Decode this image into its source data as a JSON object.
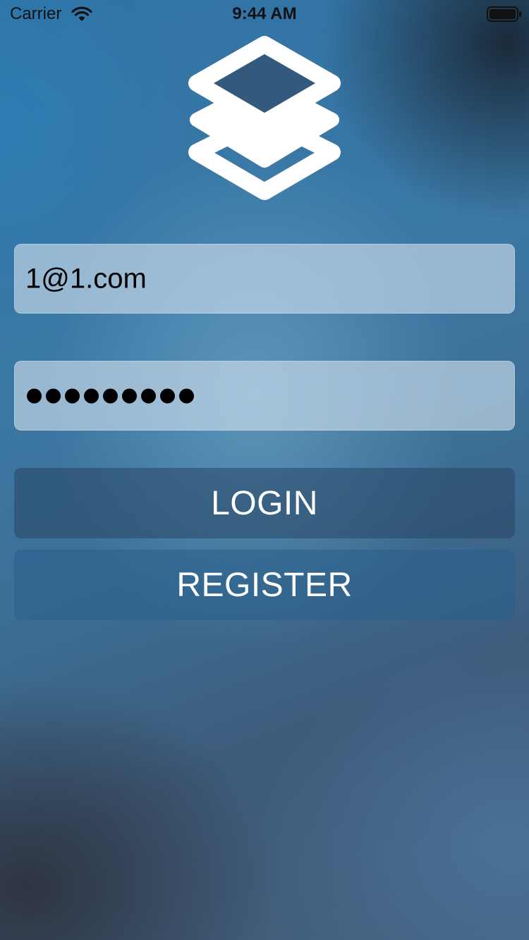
{
  "status_bar": {
    "carrier": "Carrier",
    "time": "9:44 AM"
  },
  "icons": {
    "logo": "layers-icon",
    "wifi": "wifi-icon",
    "battery": "battery-icon"
  },
  "form": {
    "email_value": "1@1.com",
    "password_mask": "•••••••••",
    "password_length": 9
  },
  "buttons": {
    "login_label": "LOGIN",
    "register_label": "REGISTER"
  },
  "colors": {
    "text_primary": "#000000",
    "button_text": "#ffffff",
    "background_accent": "#2f73a6"
  }
}
